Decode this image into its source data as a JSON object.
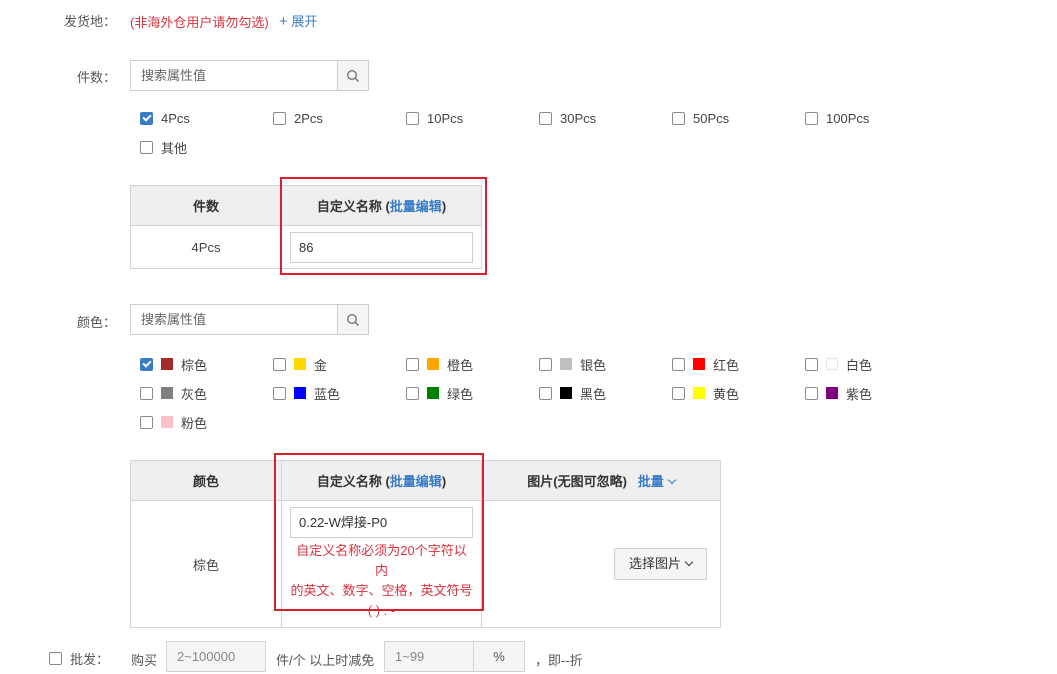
{
  "ship_from": {
    "label": "发货地：",
    "note": "(非海外仓用户请勿勾选)",
    "expand_icon": "+",
    "expand": "展开"
  },
  "quantity": {
    "label": "件数：",
    "search_placeholder": "搜索属性值",
    "options": [
      {
        "label": "4Pcs",
        "checked": true
      },
      {
        "label": "2Pcs",
        "checked": false
      },
      {
        "label": "10Pcs",
        "checked": false
      },
      {
        "label": "30Pcs",
        "checked": false
      },
      {
        "label": "50Pcs",
        "checked": false
      },
      {
        "label": "100Pcs",
        "checked": false
      },
      {
        "label": "其他",
        "checked": false
      }
    ],
    "table": {
      "col1": "件数",
      "col2_prefix": "自定义名称 (",
      "col2_link": "批量编辑",
      "col2_suffix": ")",
      "rows": [
        {
          "name": "4Pcs",
          "custom": "86"
        }
      ]
    }
  },
  "color": {
    "label": "颜色：",
    "search_placeholder": "搜索属性值",
    "options": [
      {
        "label": "棕色",
        "swatch": "#a52a2a",
        "checked": true
      },
      {
        "label": "金",
        "swatch": "#ffd700",
        "checked": false
      },
      {
        "label": "橙色",
        "swatch": "#ffa500",
        "checked": false
      },
      {
        "label": "银色",
        "swatch": "#c0c0c0",
        "checked": false
      },
      {
        "label": "红色",
        "swatch": "#ff0000",
        "checked": false
      },
      {
        "label": "白色",
        "swatch": "#ffffff",
        "checked": false
      },
      {
        "label": "灰色",
        "swatch": "#808080",
        "checked": false
      },
      {
        "label": "蓝色",
        "swatch": "#0000ff",
        "checked": false
      },
      {
        "label": "绿色",
        "swatch": "#008000",
        "checked": false
      },
      {
        "label": "黑色",
        "swatch": "#000000",
        "checked": false
      },
      {
        "label": "黄色",
        "swatch": "#ffff00",
        "checked": false
      },
      {
        "label": "紫色",
        "swatch": "#800080",
        "checked": false
      },
      {
        "label": "粉色",
        "swatch": "#ffc0cb",
        "checked": false
      }
    ],
    "table": {
      "col1": "颜色",
      "col2_prefix": "自定义名称 (",
      "col2_link": "批量编辑",
      "col2_suffix": ")",
      "col3": "图片(无图可忽略)",
      "col3_link": "批量",
      "rows": [
        {
          "name": "棕色",
          "custom": "0.22-W焊接-P0",
          "error_line1": "自定义名称必须为20个字符以内",
          "error_line2": "的英文、数字、空格，英文符号",
          "error_line3": "( ) . -",
          "pick_image": "选择图片"
        }
      ]
    }
  },
  "bulk": {
    "label": "批发：",
    "buy": "购买",
    "qty_placeholder": "2~100000",
    "unit_text": "件/个 以上时减免",
    "discount_placeholder": "1~99",
    "percent": "%",
    "result": "，即--折"
  },
  "colors": {
    "accent": "#3a7bc8",
    "error": "#d9333f",
    "highlight_border": "#d9212c"
  }
}
